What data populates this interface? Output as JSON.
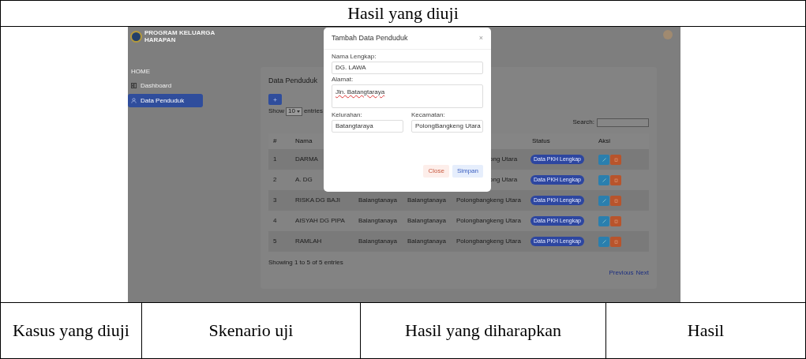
{
  "document_table": {
    "title": "Hasil yang diuji",
    "columns": [
      "Kasus yang diuji",
      "Skenario uji",
      "Hasil yang diharapkan",
      "Hasil"
    ]
  },
  "app": {
    "logo_text": [
      "PROGRAM KELUARGA",
      "HARAPAN"
    ],
    "sidebar": {
      "section": "HOME",
      "items": [
        {
          "label": "Dashboard",
          "selected": false
        },
        {
          "label": "Data Penduduk",
          "selected": true
        }
      ]
    },
    "page_title": "Data Penduduk",
    "show_entries": {
      "before": "Show",
      "value": "10",
      "after": "entries"
    },
    "search_label": "Search:",
    "table": {
      "headers_left": [
        "#",
        "Nama"
      ],
      "headers_right": [
        "Status",
        "Aksi"
      ],
      "rows": [
        {
          "kind": "covered",
          "no": "1",
          "name": "DARMA",
          "column_5": "ong Utara",
          "status": "Data PKH Lengkap"
        },
        {
          "kind": "covered",
          "no": "2",
          "name": "A. DG",
          "column_5": "ong Utara",
          "status": "Data PKH Lengkap"
        },
        {
          "kind": "full",
          "no": "3",
          "name": "RISKA DG BAJI",
          "column_3": "Balangtanaya",
          "column_4": "Balangtanaya",
          "column_5": "Polongbangkeng Utara",
          "status": "Data PKH Lengkap"
        },
        {
          "kind": "full",
          "no": "4",
          "name": "AISYAH DG PIPA",
          "column_3": "Balangtanaya",
          "column_4": "Balangtanaya",
          "column_5": "Polongbangkeng Utara",
          "status": "Data PKH Lengkap"
        },
        {
          "kind": "full",
          "no": "5",
          "name": "RAMLAH",
          "column_3": "Balangtanaya",
          "column_4": "Balangtanaya",
          "column_5": "Polongbangkeng Utara",
          "status": "Data PKH Lengkap"
        }
      ]
    },
    "footer_info": "Showing 1 to 5 of 5 entries",
    "pagination": [
      "Previous",
      "Next"
    ],
    "modal": {
      "title": "Tambah Data Penduduk",
      "close": "×",
      "fields": [
        {
          "label": "Nama Lengkap:",
          "value": "DG. LAWA"
        },
        {
          "label": "Alamat:",
          "value": "Jln. Batangtaraya"
        },
        {
          "label": "Kelurahan:",
          "value": "Batangtaraya"
        },
        {
          "label": "Kecamatan:",
          "value": "PolongBangkeng Utara"
        }
      ],
      "buttons": [
        {
          "label": "Close",
          "kind": "secondary"
        },
        {
          "label": "Simpan",
          "kind": "primary"
        }
      ]
    }
  }
}
